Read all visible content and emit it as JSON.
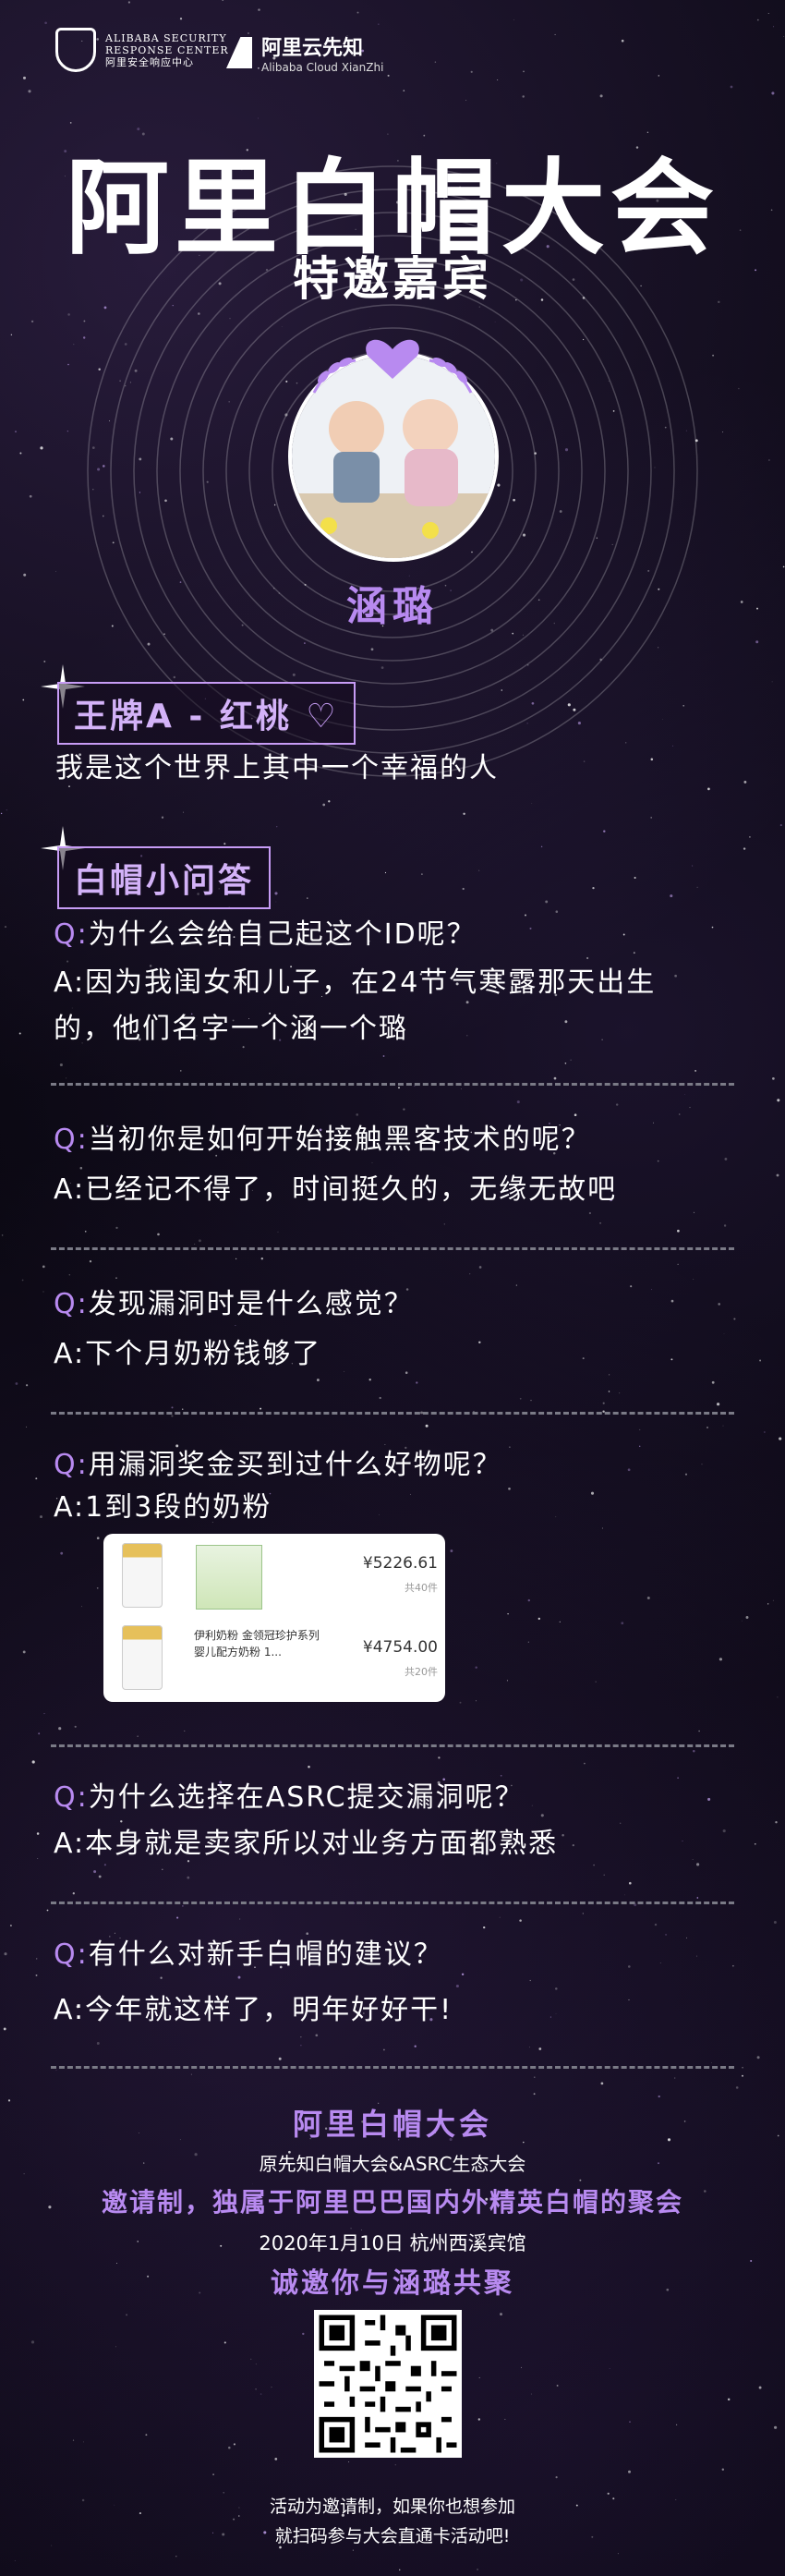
{
  "header": {
    "logo_left_line1": "ALIBABA SECURITY",
    "logo_left_line2": "RESPONSE CENTER",
    "logo_left_line3": "阿里安全响应中心",
    "logo_right_cn": "阿里云先知",
    "logo_right_en": "Alibaba Cloud XianZhi"
  },
  "hero": {
    "title": "阿里白帽大会",
    "subtitle": "特邀嘉宾",
    "guest_name": "涵璐"
  },
  "profile": {
    "label": "王牌A - 红桃",
    "heart_icon": "heart-outline-icon",
    "motto": "我是这个世界上其中一个幸福的人"
  },
  "qa_section": {
    "label": "白帽小问答",
    "items": [
      {
        "q": "为什么会给自己起这个ID呢？",
        "a_line1": "因为我闺女和儿子，在24节气寒露那天出生",
        "a_line2": "的，他们名字一个涵一个璐"
      },
      {
        "q": "当初你是如何开始接触黑客技术的呢？",
        "a_line1": "已经记不得了，时间挺久的，无缘无故吧"
      },
      {
        "q": "发现漏洞时是什么感觉？",
        "a_line1": "下个月奶粉钱够了"
      },
      {
        "q": "用漏洞奖金买到过什么好物呢？",
        "a_line1": "1到3段的奶粉"
      },
      {
        "q": "为什么选择在ASRC提交漏洞呢？",
        "a_line1": "本身就是卖家所以对业务方面都熟悉"
      },
      {
        "q": "有什么对新手白帽的建议？",
        "a_line1": "今年就这样了，明年好好干!"
      }
    ],
    "q_prefix": "Q:",
    "a_prefix": "A:"
  },
  "order_card": {
    "row1_price": "¥5226.61",
    "row1_count": "共40件",
    "row2_name": "伊利奶粉 金领冠珍护系列 婴儿配方奶粉 1...",
    "row2_price": "¥4754.00",
    "row2_count": "共20件"
  },
  "footer": {
    "title": "阿里白帽大会",
    "subtitle": "原先知白帽大会&ASRC生态大会",
    "invite": "邀请制，独属于阿里巴巴国内外精英白帽的聚会",
    "date": "2020年1月10日 杭州西溪宾馆",
    "call": "诚邀你与涵璐共聚",
    "note_line1": "活动为邀请制，如果你也想参加",
    "note_line2": "就扫码参与大会直通卡活动吧!"
  },
  "colors": {
    "accent": "#b88af0",
    "label_border": "#c79cf5",
    "background": "#0b0812",
    "divider": "#7a7a86"
  }
}
